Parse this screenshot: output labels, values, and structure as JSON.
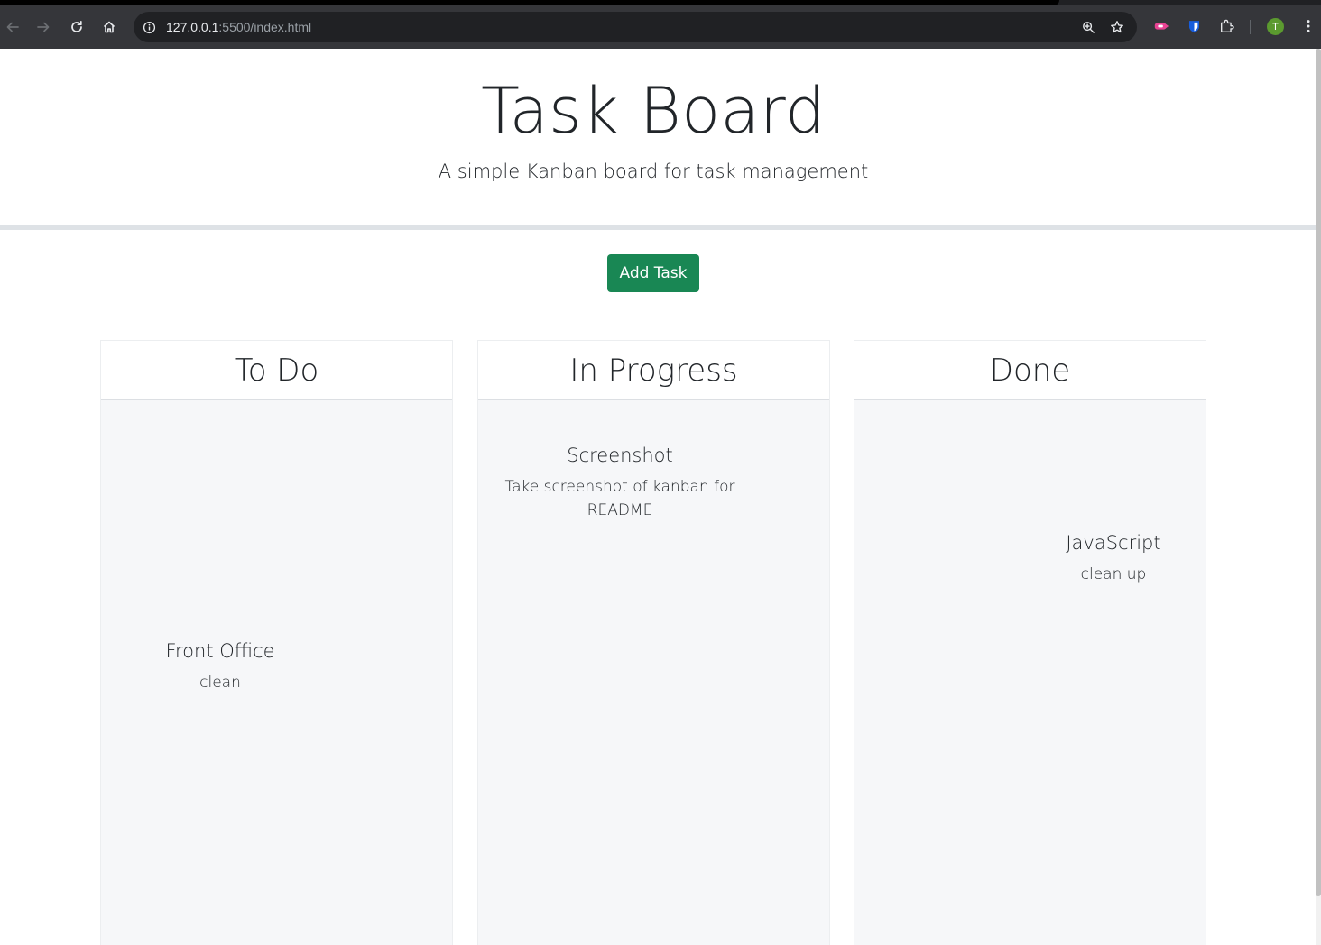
{
  "browser": {
    "url_host": "127.0.0.1",
    "url_rest": ":5500/index.html",
    "profile_initial": "T",
    "icons": [
      "back-arrow-icon",
      "forward-arrow-icon",
      "reload-icon",
      "home-icon",
      "site-info-icon",
      "zoom-icon",
      "bookmark-star-icon",
      "extension-pink-icon",
      "bitwarden-shield-icon",
      "extensions-puzzle-icon",
      "kebab-menu-icon"
    ]
  },
  "header": {
    "title": "Task Board",
    "subtitle": "A simple Kanban board for task management"
  },
  "toolbar": {
    "add_task_label": "Add Task",
    "add_task_color": "#198754"
  },
  "lanes": [
    {
      "title": "To Do",
      "tasks": [
        {
          "title": "Front Office",
          "description": "clean"
        }
      ]
    },
    {
      "title": "In Progress",
      "tasks": [
        {
          "title": "Screenshot",
          "description": "Take screenshot of kanban for README"
        }
      ]
    },
    {
      "title": "Done",
      "tasks": [
        {
          "title": "JavaScript",
          "description": "clean up"
        }
      ]
    }
  ]
}
